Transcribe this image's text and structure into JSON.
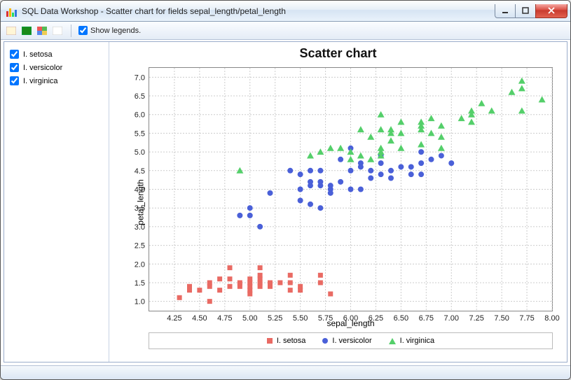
{
  "window": {
    "title": "SQL Data Workshop - Scatter chart for fields sepal_length/petal_length"
  },
  "toolbar": {
    "show_legends_label": "Show legends."
  },
  "sidebar": {
    "series": [
      {
        "label": "I. setosa",
        "checked": true
      },
      {
        "label": "I. versicolor",
        "checked": true
      },
      {
        "label": "I. virginica",
        "checked": true
      }
    ]
  },
  "legend": {
    "s0": "I. setosa",
    "s1": "I. versicolor",
    "s2": "I. virginica"
  },
  "chart_data": {
    "type": "scatter",
    "title": "Scatter chart",
    "xlabel": "sepal_length",
    "ylabel": "petal_length",
    "xlim": [
      4.0,
      8.0
    ],
    "ylim": [
      0.75,
      7.25
    ],
    "xticks": [
      4.25,
      4.5,
      4.75,
      5.0,
      5.25,
      5.5,
      5.75,
      6.0,
      6.25,
      6.5,
      6.75,
      7.0,
      7.25,
      7.5,
      7.75,
      8.0
    ],
    "yticks": [
      1.0,
      1.5,
      2.0,
      2.5,
      3.0,
      3.5,
      4.0,
      4.5,
      5.0,
      5.5,
      6.0,
      6.5,
      7.0
    ],
    "series": [
      {
        "name": "I. setosa",
        "marker": "square",
        "color": "#e96a63",
        "points": [
          [
            4.3,
            1.1
          ],
          [
            4.4,
            1.3
          ],
          [
            4.4,
            1.4
          ],
          [
            4.5,
            1.3
          ],
          [
            4.6,
            1.0
          ],
          [
            4.6,
            1.4
          ],
          [
            4.6,
            1.5
          ],
          [
            4.7,
            1.3
          ],
          [
            4.7,
            1.6
          ],
          [
            4.8,
            1.4
          ],
          [
            4.8,
            1.6
          ],
          [
            4.8,
            1.9
          ],
          [
            4.9,
            1.4
          ],
          [
            4.9,
            1.5
          ],
          [
            5.0,
            1.2
          ],
          [
            5.0,
            1.3
          ],
          [
            5.0,
            1.4
          ],
          [
            5.0,
            1.5
          ],
          [
            5.0,
            1.6
          ],
          [
            5.1,
            1.4
          ],
          [
            5.1,
            1.5
          ],
          [
            5.1,
            1.6
          ],
          [
            5.1,
            1.7
          ],
          [
            5.1,
            1.9
          ],
          [
            5.2,
            1.4
          ],
          [
            5.2,
            1.5
          ],
          [
            5.3,
            1.5
          ],
          [
            5.4,
            1.3
          ],
          [
            5.4,
            1.5
          ],
          [
            5.4,
            1.7
          ],
          [
            5.5,
            1.3
          ],
          [
            5.5,
            1.4
          ],
          [
            5.7,
            1.5
          ],
          [
            5.7,
            1.7
          ],
          [
            5.8,
            1.2
          ]
        ]
      },
      {
        "name": "I. versicolor",
        "marker": "circle",
        "color": "#4a60d8",
        "points": [
          [
            4.9,
            3.3
          ],
          [
            5.0,
            3.3
          ],
          [
            5.0,
            3.5
          ],
          [
            5.1,
            3.0
          ],
          [
            5.2,
            3.9
          ],
          [
            5.4,
            4.5
          ],
          [
            5.5,
            3.7
          ],
          [
            5.5,
            4.0
          ],
          [
            5.5,
            4.4
          ],
          [
            5.6,
            3.6
          ],
          [
            5.6,
            4.1
          ],
          [
            5.6,
            4.2
          ],
          [
            5.6,
            4.5
          ],
          [
            5.7,
            3.5
          ],
          [
            5.7,
            4.1
          ],
          [
            5.7,
            4.2
          ],
          [
            5.7,
            4.5
          ],
          [
            5.8,
            3.9
          ],
          [
            5.8,
            4.0
          ],
          [
            5.8,
            4.1
          ],
          [
            5.9,
            4.2
          ],
          [
            5.9,
            4.8
          ],
          [
            6.0,
            4.0
          ],
          [
            6.0,
            4.5
          ],
          [
            6.0,
            5.1
          ],
          [
            6.1,
            4.0
          ],
          [
            6.1,
            4.6
          ],
          [
            6.1,
            4.7
          ],
          [
            6.2,
            4.3
          ],
          [
            6.2,
            4.5
          ],
          [
            6.3,
            4.4
          ],
          [
            6.3,
            4.7
          ],
          [
            6.3,
            4.9
          ],
          [
            6.4,
            4.3
          ],
          [
            6.4,
            4.5
          ],
          [
            6.5,
            4.6
          ],
          [
            6.6,
            4.4
          ],
          [
            6.6,
            4.6
          ],
          [
            6.7,
            4.4
          ],
          [
            6.7,
            4.7
          ],
          [
            6.7,
            5.0
          ],
          [
            6.8,
            4.8
          ],
          [
            6.9,
            4.9
          ],
          [
            7.0,
            4.7
          ]
        ]
      },
      {
        "name": "I. virginica",
        "marker": "triangle",
        "color": "#54cf6a",
        "points": [
          [
            4.9,
            4.5
          ],
          [
            5.6,
            4.9
          ],
          [
            5.7,
            5.0
          ],
          [
            5.8,
            5.1
          ],
          [
            5.9,
            5.1
          ],
          [
            6.0,
            4.8
          ],
          [
            6.0,
            5.0
          ],
          [
            6.1,
            4.9
          ],
          [
            6.1,
            5.6
          ],
          [
            6.2,
            4.8
          ],
          [
            6.2,
            5.4
          ],
          [
            6.3,
            4.9
          ],
          [
            6.3,
            5.0
          ],
          [
            6.3,
            5.1
          ],
          [
            6.3,
            5.6
          ],
          [
            6.3,
            6.0
          ],
          [
            6.4,
            5.3
          ],
          [
            6.4,
            5.5
          ],
          [
            6.4,
            5.6
          ],
          [
            6.5,
            5.1
          ],
          [
            6.5,
            5.5
          ],
          [
            6.5,
            5.8
          ],
          [
            6.7,
            5.2
          ],
          [
            6.7,
            5.6
          ],
          [
            6.7,
            5.7
          ],
          [
            6.7,
            5.8
          ],
          [
            6.8,
            5.5
          ],
          [
            6.8,
            5.9
          ],
          [
            6.9,
            5.1
          ],
          [
            6.9,
            5.4
          ],
          [
            6.9,
            5.7
          ],
          [
            7.1,
            5.9
          ],
          [
            7.2,
            5.8
          ],
          [
            7.2,
            6.0
          ],
          [
            7.2,
            6.1
          ],
          [
            7.3,
            6.3
          ],
          [
            7.4,
            6.1
          ],
          [
            7.6,
            6.6
          ],
          [
            7.7,
            6.1
          ],
          [
            7.7,
            6.7
          ],
          [
            7.7,
            6.9
          ],
          [
            7.9,
            6.4
          ]
        ]
      }
    ]
  }
}
